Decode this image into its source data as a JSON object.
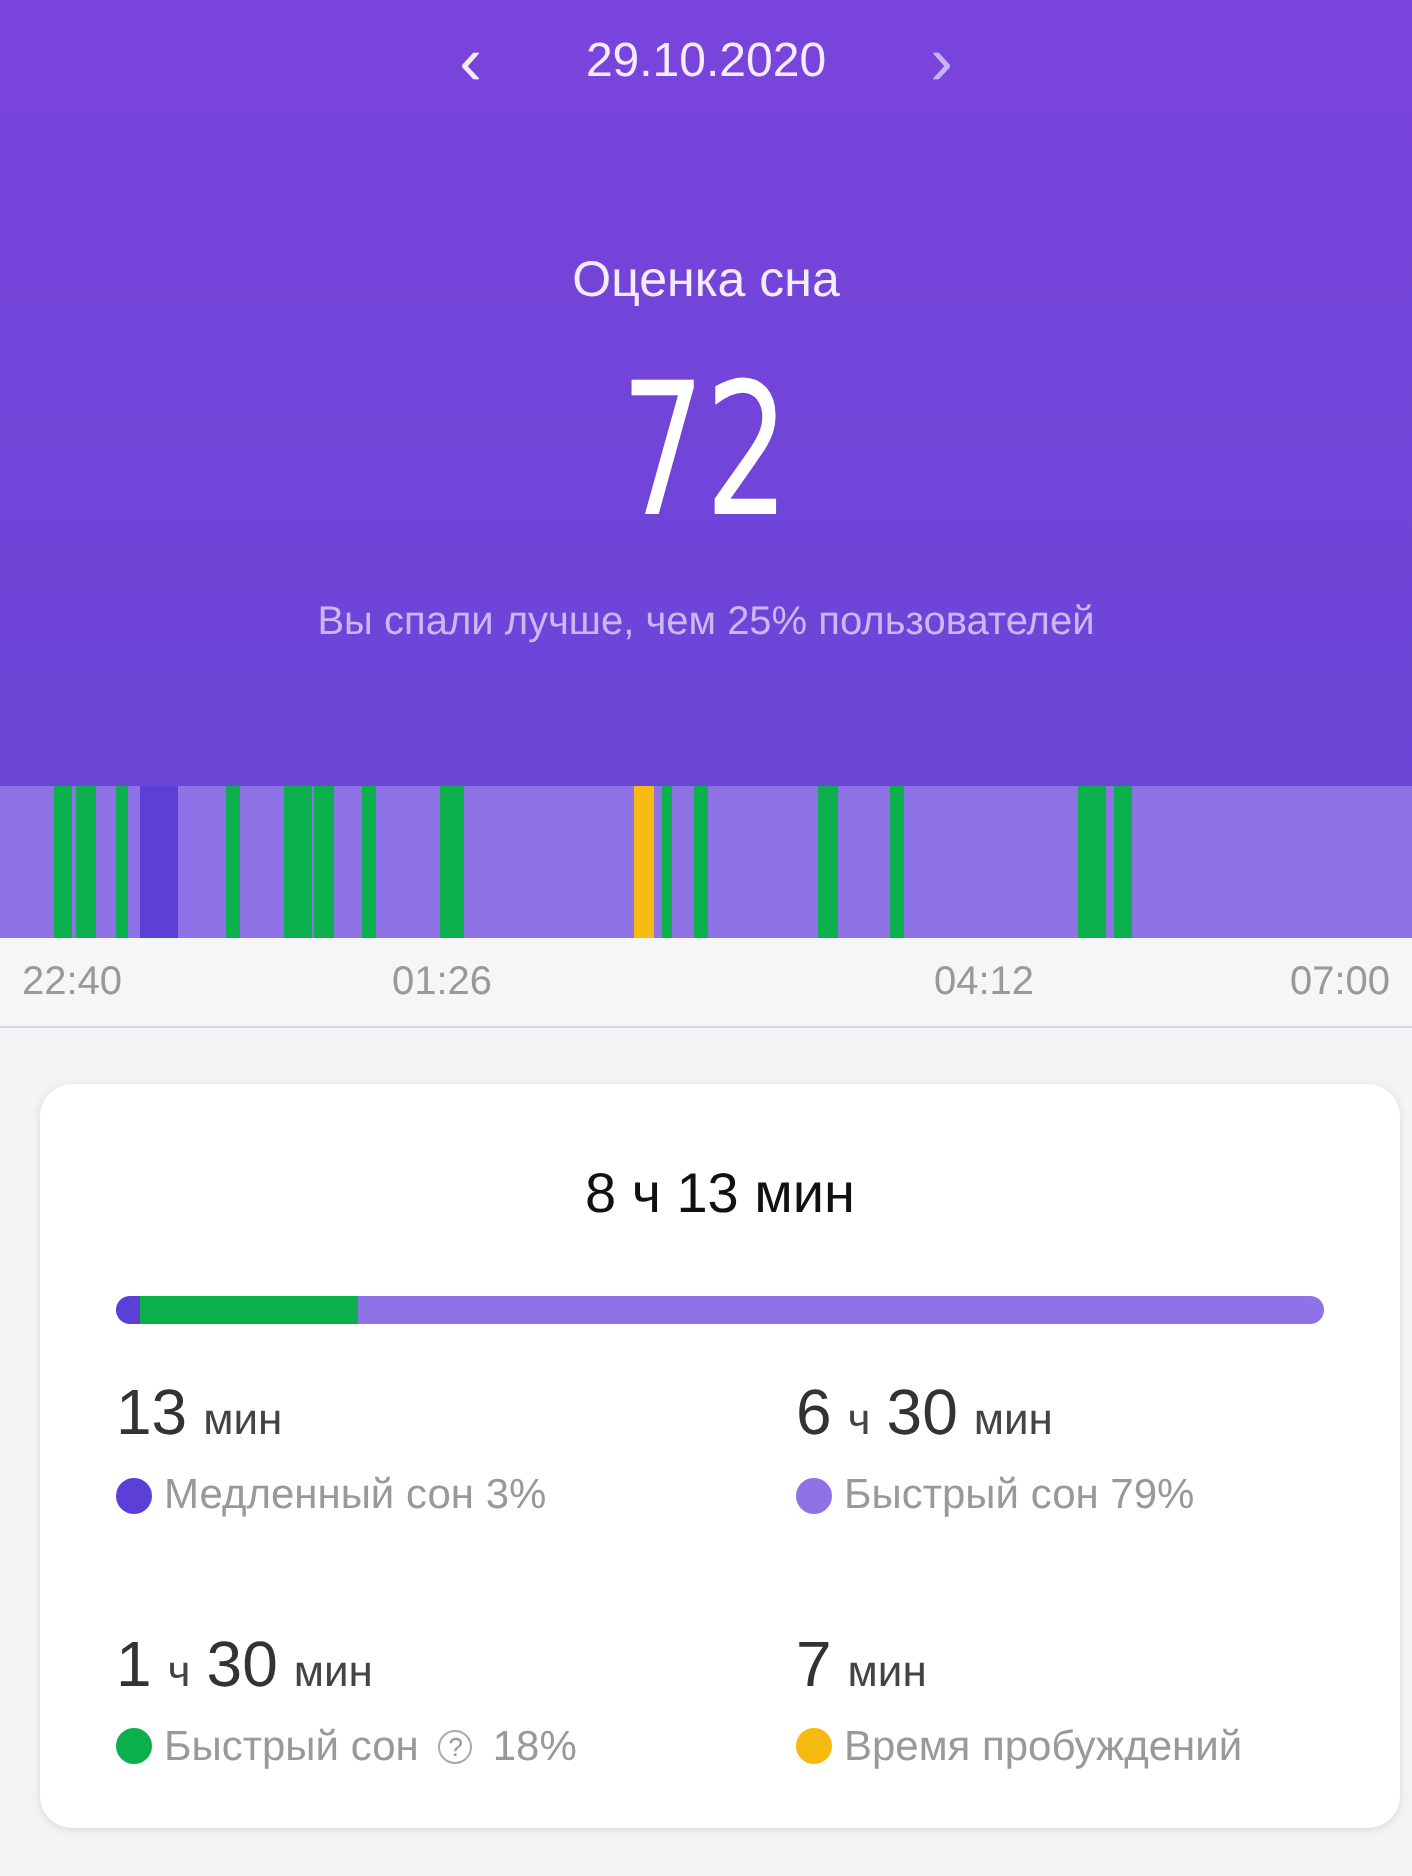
{
  "date_nav": {
    "prev": "‹",
    "date": "29.10.2020",
    "next": "›"
  },
  "score": {
    "title": "Оценка сна",
    "value": "72",
    "comparison": "Вы спали лучше, чем 25% пользователей"
  },
  "timeline": {
    "labels": [
      "22:40",
      "01:26",
      "04:12",
      "07:00"
    ]
  },
  "summary": {
    "total": "8 ч 13 мин",
    "bar": [
      {
        "color": "#5b3fd6"
      },
      {
        "color": "#0bb04c"
      },
      {
        "color": "#8f73e6"
      }
    ],
    "stats": [
      {
        "parts": [
          {
            "kind": "number",
            "text": "13"
          },
          {
            "kind": "unit",
            "text": "мин"
          }
        ],
        "label": "Медленный сон 3%",
        "color": "#5b3fd6"
      },
      {
        "parts": [
          {
            "kind": "number",
            "text": "6"
          },
          {
            "kind": "unit",
            "text": "ч"
          },
          {
            "kind": "number",
            "text": "30"
          },
          {
            "kind": "unit",
            "text": "мин"
          }
        ],
        "label": "Быстрый сон 79%",
        "color": "#8f73e6"
      },
      {
        "parts": [
          {
            "kind": "number",
            "text": "1"
          },
          {
            "kind": "unit",
            "text": "ч"
          },
          {
            "kind": "number",
            "text": "30"
          },
          {
            "kind": "unit",
            "text": "мин"
          }
        ],
        "label": "Быстрый сон",
        "help": "?",
        "suffix": "18%",
        "color": "#0bb04c"
      },
      {
        "parts": [
          {
            "kind": "number",
            "text": "7"
          },
          {
            "kind": "unit",
            "text": "мин"
          }
        ],
        "label": "Время пробуждений",
        "color": "#f5b90f"
      }
    ]
  }
}
